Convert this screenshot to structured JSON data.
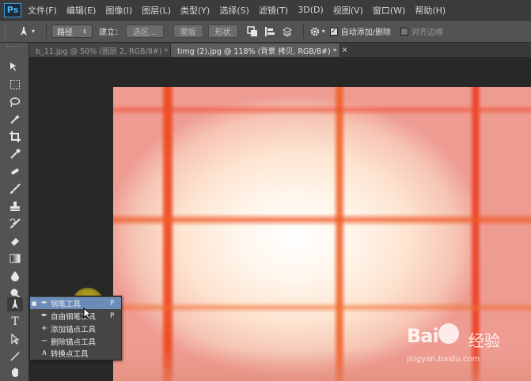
{
  "app": {
    "logo": "Ps"
  },
  "menu": [
    "文件(F)",
    "编辑(E)",
    "图像(I)",
    "图层(L)",
    "类型(Y)",
    "选择(S)",
    "滤镜(T)",
    "3D(D)",
    "视图(V)",
    "窗口(W)",
    "帮助(H)"
  ],
  "options": {
    "mode_value": "路径",
    "build_label": "建立：",
    "selection_btn": "选区...",
    "mask_btn": "蒙版",
    "shape_btn": "形状",
    "auto_add_delete_label": "自动添加/删除",
    "auto_add_delete_checked": true,
    "align_edges_label": "对齐边缘",
    "align_edges_checked": false
  },
  "tabs": [
    {
      "label": "b_11.jpg @ 50% (图层 2, RGB/8#) *",
      "close": "×",
      "active": false
    },
    {
      "label": "timg (2).jpg @ 118% (背景 拷贝, RGB/8#) *",
      "close": "×",
      "active": true
    }
  ],
  "pen_flyout": [
    {
      "label": "钢笔工具",
      "shortcut": "P",
      "selected": true,
      "icon": "pen-icon"
    },
    {
      "label": "自由钢笔工具",
      "shortcut": "P",
      "selected": false,
      "icon": "freeform-pen-icon"
    },
    {
      "label": "添加锚点工具",
      "shortcut": "",
      "selected": false,
      "icon": "add-anchor-icon"
    },
    {
      "label": "删除锚点工具",
      "shortcut": "",
      "selected": false,
      "icon": "delete-anchor-icon"
    },
    {
      "label": "转换点工具",
      "shortcut": "",
      "selected": false,
      "icon": "convert-point-icon"
    }
  ],
  "watermark": {
    "logo": "Bai",
    "logo_end": "经验",
    "url": "jingyan.baidu.com"
  }
}
